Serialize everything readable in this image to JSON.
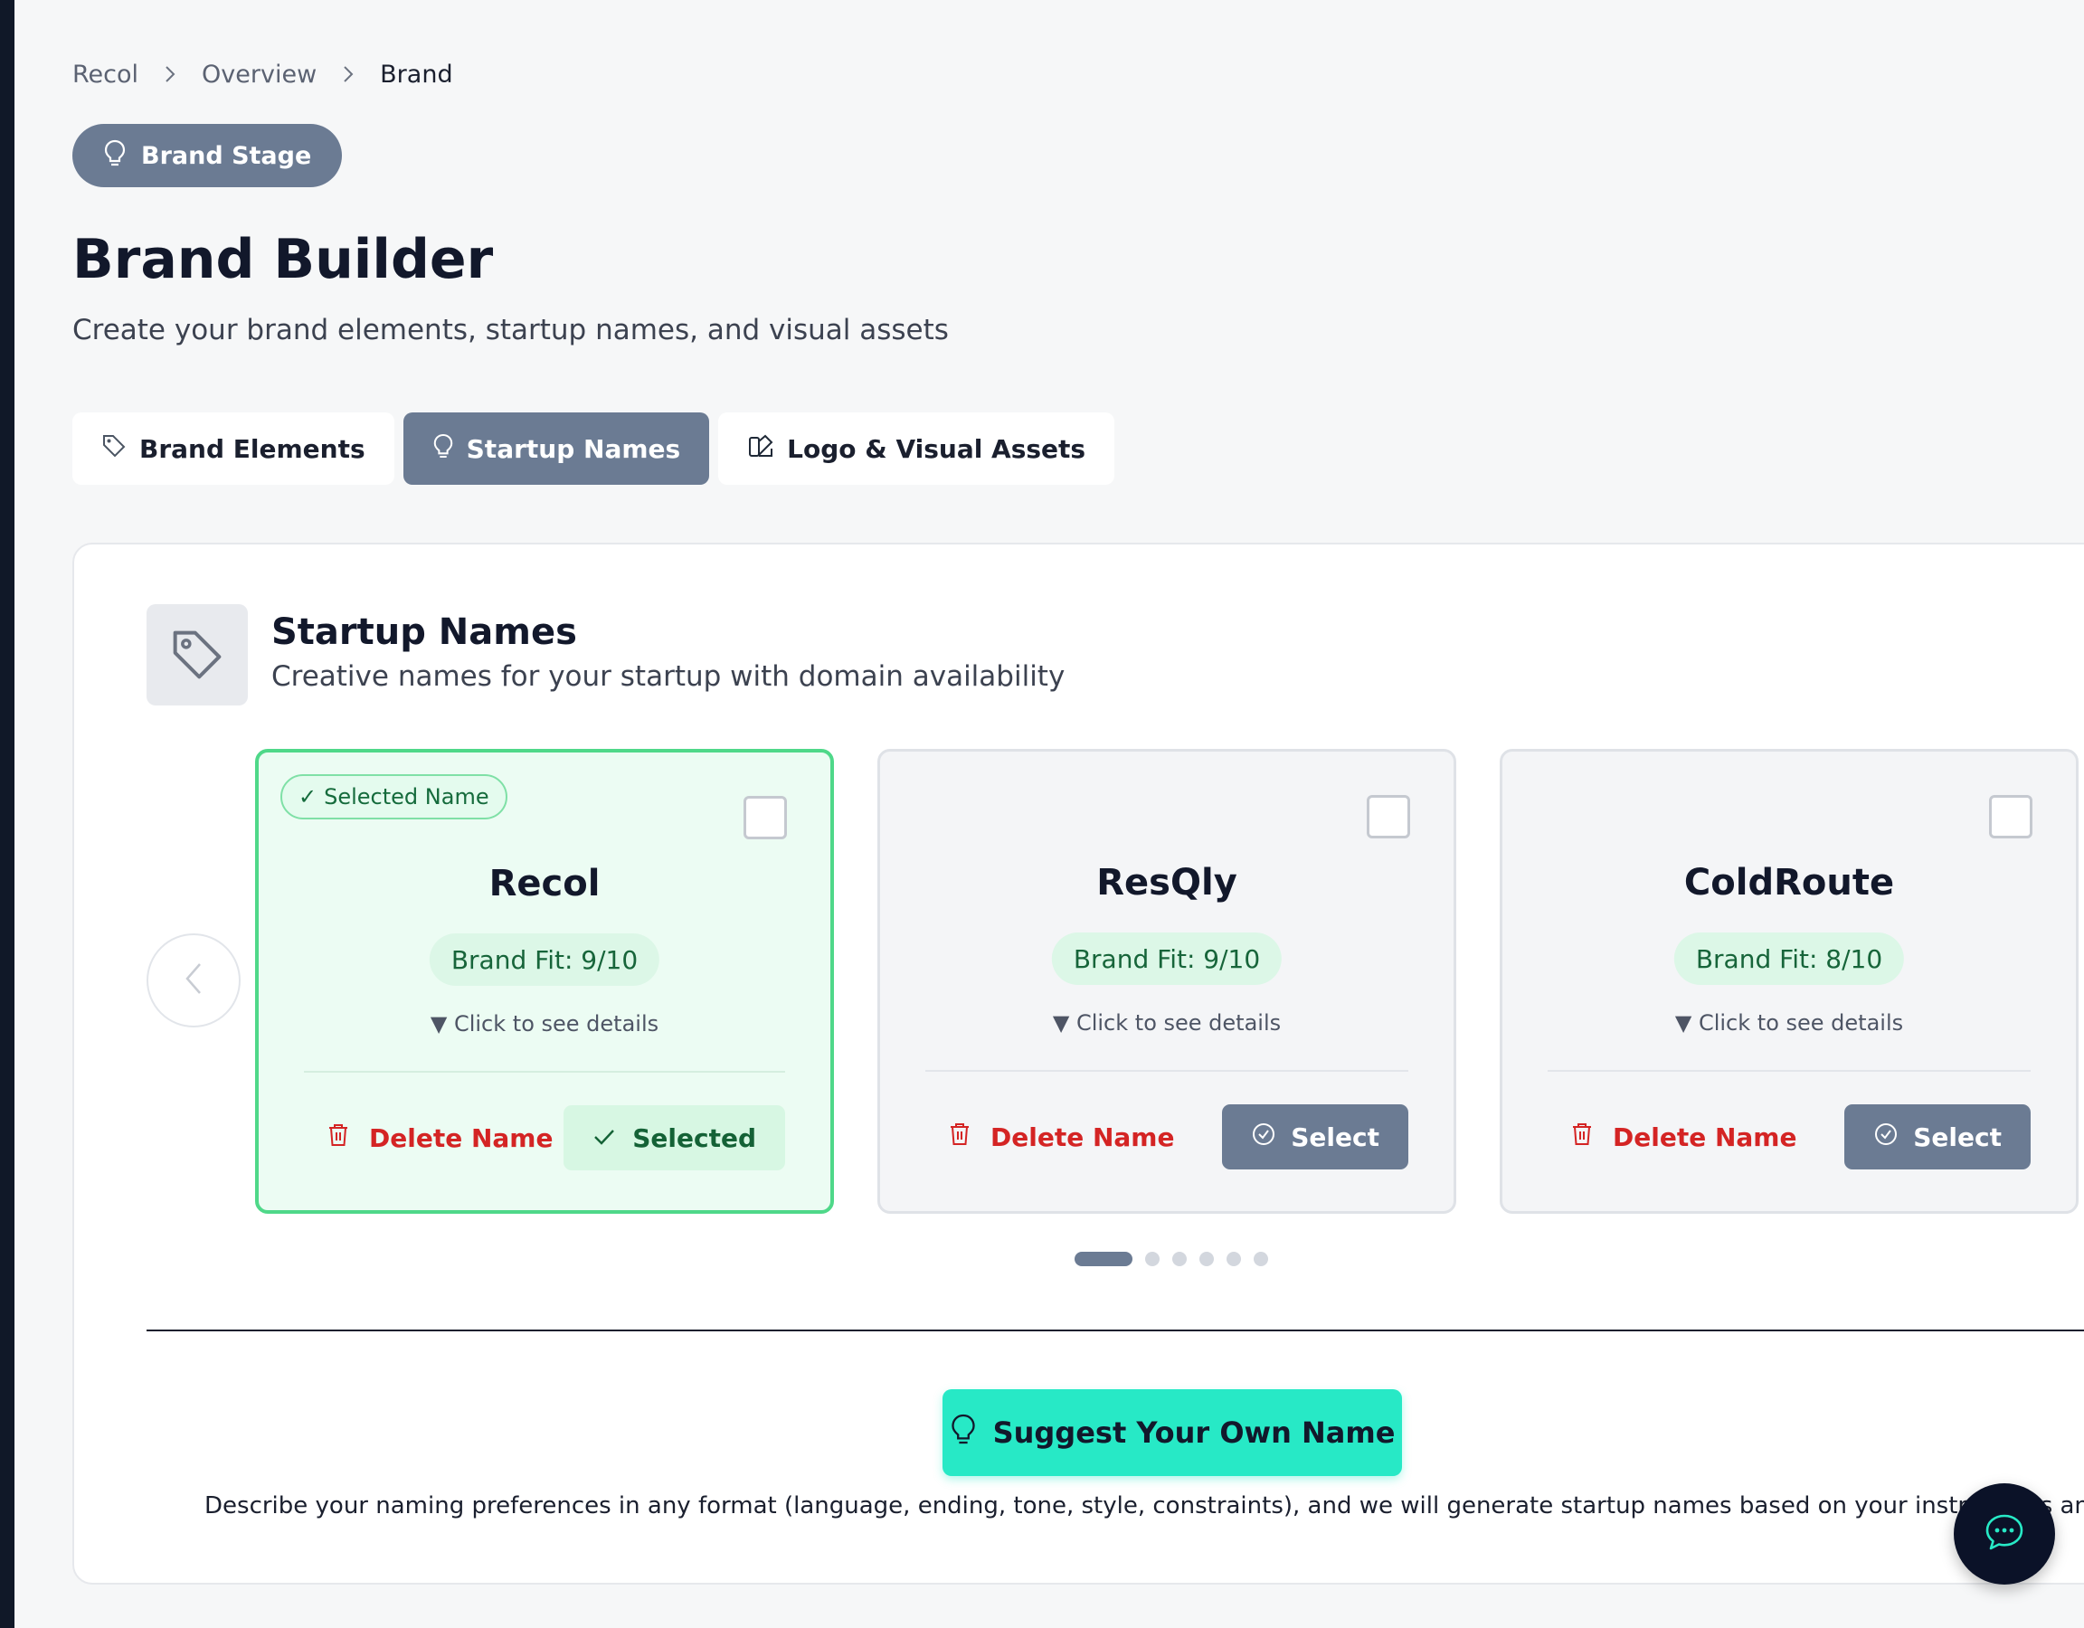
{
  "breadcrumb": {
    "items": [
      "Recol",
      "Overview",
      "Brand"
    ]
  },
  "stage": {
    "label": "Brand Stage"
  },
  "page": {
    "title": "Brand Builder",
    "subtitle": "Create your brand elements, startup names, and visual assets"
  },
  "tabs": [
    {
      "label": "Brand Elements",
      "icon": "tag-icon",
      "active": false
    },
    {
      "label": "Startup Names",
      "icon": "lightbulb-icon",
      "active": true
    },
    {
      "label": "Logo & Visual Assets",
      "icon": "palette-icon",
      "active": false
    }
  ],
  "section": {
    "title": "Startup Names",
    "subtitle": "Creative names for your startup with domain availability"
  },
  "names": [
    {
      "name": "Recol",
      "fit": "Brand Fit: 9/10",
      "details": "▼ Click to see details",
      "delete_label": "Delete Name",
      "action_label": "Selected",
      "selected": true,
      "badge": "Selected Name"
    },
    {
      "name": "ResQly",
      "fit": "Brand Fit: 9/10",
      "details": "▼ Click to see details",
      "delete_label": "Delete Name",
      "action_label": "Select",
      "selected": false
    },
    {
      "name": "ColdRoute",
      "fit": "Brand Fit: 8/10",
      "details": "▼ Click to see details",
      "delete_label": "Delete Name",
      "action_label": "Select",
      "selected": false
    }
  ],
  "pagination": {
    "total": 6,
    "current": 1
  },
  "suggest": {
    "button_label": "Suggest Your Own Name",
    "description": "Describe your naming preferences in any format (language, ending, tone, style, constraints), and we will generate startup names based on your instructions and Lea"
  },
  "colors": {
    "accent": "#6b7b93",
    "success": "#4fd889",
    "danger": "#d42424",
    "cta": "#27e9c6"
  }
}
